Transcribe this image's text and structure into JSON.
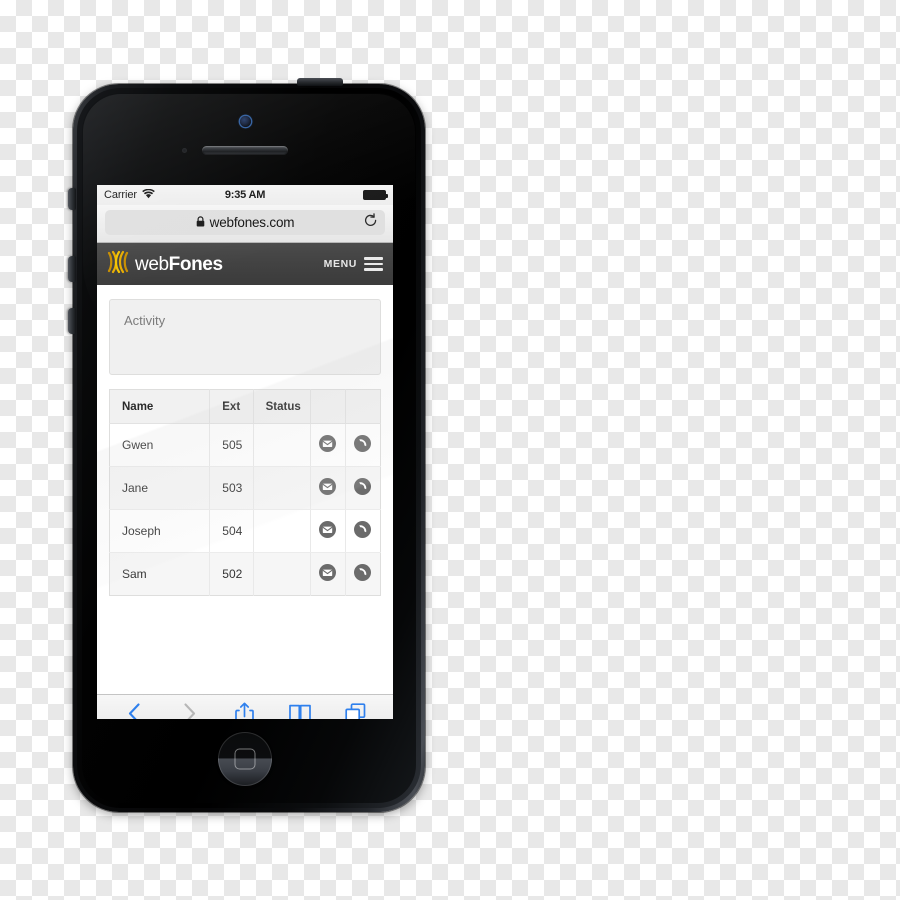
{
  "device": {
    "name": "iphone-5-black",
    "camera_icon": "front-camera",
    "speaker_icon": "earpiece-speaker",
    "home_button_icon": "home-button"
  },
  "status_bar": {
    "carrier": "Carrier",
    "wifi_icon": "wifi-icon",
    "time": "9:35 AM",
    "battery_icon": "battery-full-icon"
  },
  "browser": {
    "lock_icon": "lock-icon",
    "url": "webfones.com",
    "reload_icon": "reload-icon",
    "toolbar": {
      "back_icon": "chevron-left-icon",
      "forward_icon": "chevron-right-icon",
      "share_icon": "share-icon",
      "bookmarks_icon": "book-icon",
      "tabs_icon": "tabs-icon",
      "active_color": "#2f80ed",
      "disabled_color": "#b7b7b7"
    }
  },
  "site": {
    "header": {
      "logo_mark_icon": "webfones-logo-mark",
      "logo_text_light": "web",
      "logo_text_bold": "Fones",
      "menu_label": "MENU",
      "menu_icon": "hamburger-menu-icon",
      "background_color": "#434343",
      "logo_accent_color": "#f0b800"
    },
    "activity_panel": {
      "title": "Activity"
    },
    "extensions_table": {
      "columns": [
        "Name",
        "Ext",
        "Status",
        "",
        ""
      ],
      "rows": [
        {
          "name": "Gwen",
          "ext": "505",
          "status": "",
          "email_icon": "envelope-icon",
          "call_icon": "phone-icon"
        },
        {
          "name": "Jane",
          "ext": "503",
          "status": "",
          "email_icon": "envelope-icon",
          "call_icon": "phone-icon"
        },
        {
          "name": "Joseph",
          "ext": "504",
          "status": "",
          "email_icon": "envelope-icon",
          "call_icon": "phone-icon"
        },
        {
          "name": "Sam",
          "ext": "502",
          "status": "",
          "email_icon": "envelope-icon",
          "call_icon": "phone-icon"
        }
      ],
      "icon_color": "#6b6b6b"
    }
  }
}
